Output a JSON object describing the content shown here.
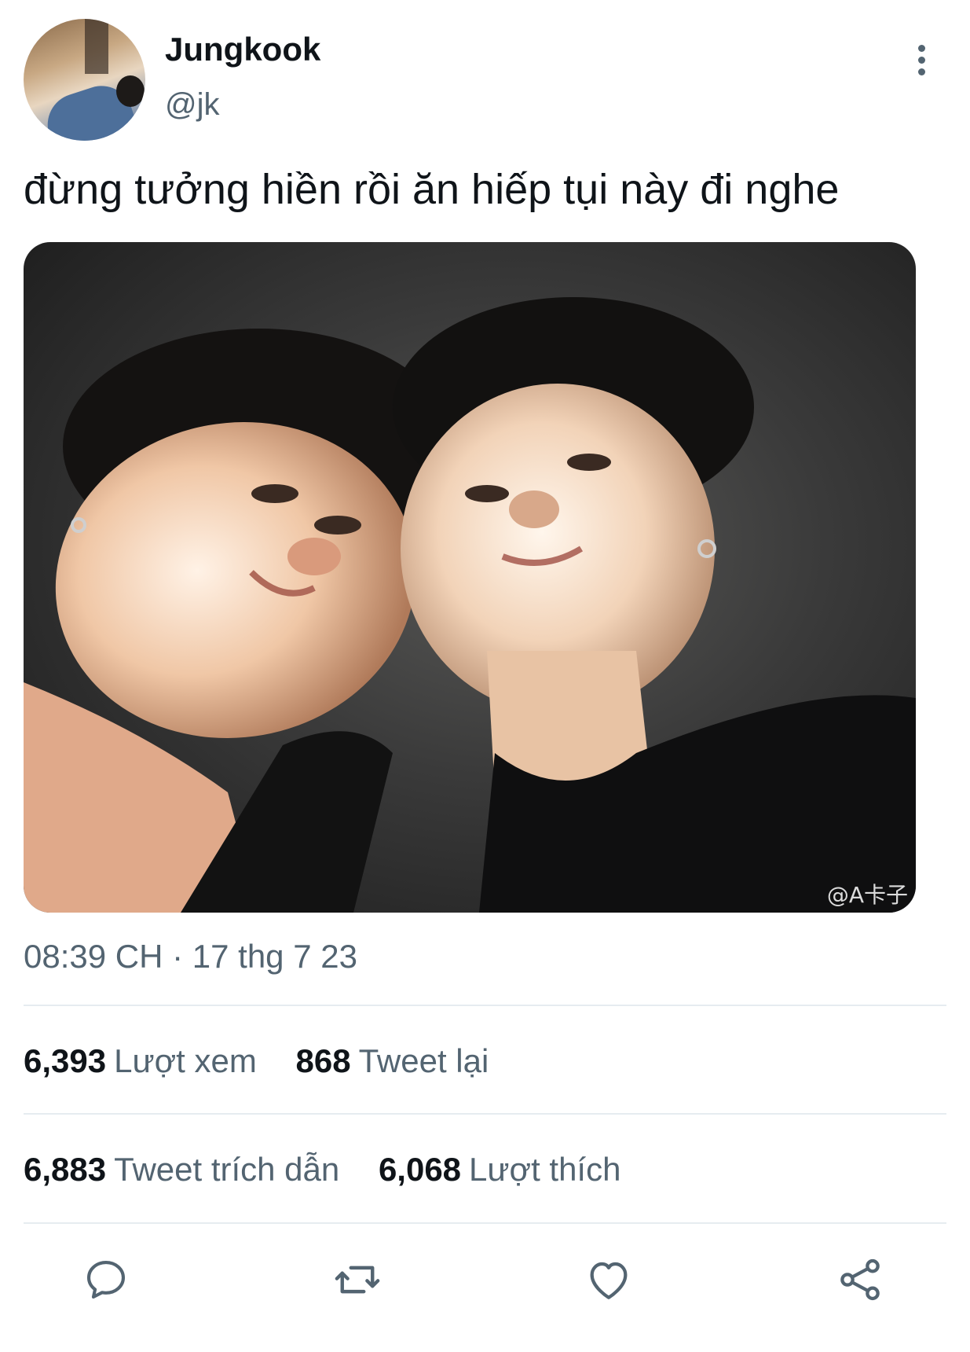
{
  "author": {
    "name": "Jungkook",
    "handle": "@jk"
  },
  "tweet": {
    "text": "đừng tưởng hiền rồi ăn hiếp tụi này đi nghe",
    "timestamp": "08:39 CH · 17 thg 7 23",
    "media_watermark": "@A卡子"
  },
  "stats": {
    "views_count": "6,393",
    "views_label": "Lượt xem",
    "retweets_count": "868",
    "retweets_label": "Tweet lại",
    "quotes_count": "6,883",
    "quotes_label": "Tweet trích dẫn",
    "likes_count": "6,068",
    "likes_label": "Lượt thích"
  },
  "actions": {
    "icons": [
      "reply-icon",
      "retweet-icon",
      "like-icon",
      "share-icon"
    ]
  },
  "colors": {
    "text_primary": "#0f1419",
    "text_secondary": "#536471",
    "icon": "#536471",
    "divider": "#e6ecf0"
  }
}
